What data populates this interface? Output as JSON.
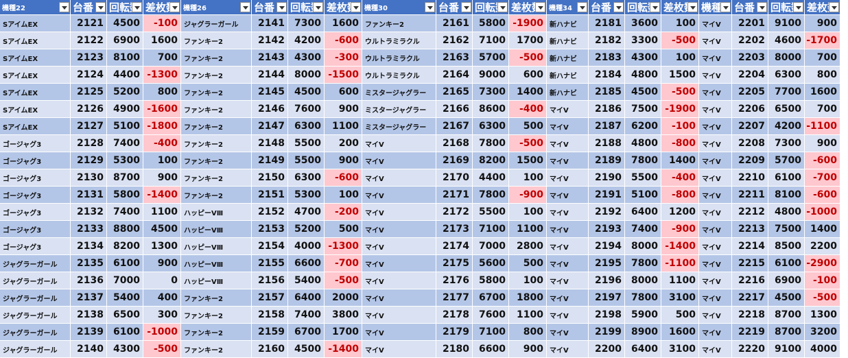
{
  "colors": {
    "header_bg": "#4472c4",
    "band_dark": "#b4c6e7",
    "band_light": "#d9e1f2",
    "negative_fill": "#ffc7ce",
    "negative_text": "#c00000"
  },
  "headers": [
    {
      "label": "機種22",
      "size": "small"
    },
    {
      "label": "台番",
      "size": "big"
    },
    {
      "label": "回転数",
      "size": "big"
    },
    {
      "label": "差枚数",
      "size": "big"
    },
    {
      "label": "機種26",
      "size": "small"
    },
    {
      "label": "台番",
      "size": "big"
    },
    {
      "label": "回転数",
      "size": "big"
    },
    {
      "label": "差枚数",
      "size": "big"
    },
    {
      "label": "機種30",
      "size": "small"
    },
    {
      "label": "台番",
      "size": "big"
    },
    {
      "label": "回転数",
      "size": "big"
    },
    {
      "label": "差枚数",
      "size": "big"
    },
    {
      "label": "機種34",
      "size": "small"
    },
    {
      "label": "台番",
      "size": "big"
    },
    {
      "label": "回転数",
      "size": "big"
    },
    {
      "label": "差枚数",
      "size": "big"
    },
    {
      "label": "機種",
      "size": "big"
    },
    {
      "label": "台番",
      "size": "big"
    },
    {
      "label": "回転数",
      "size": "big"
    },
    {
      "label": "差枚数",
      "size": "big"
    }
  ],
  "rows": [
    [
      "SアイムEX",
      "2121",
      "4500",
      "-100",
      "ジャグラーガール",
      "2141",
      "7300",
      "1600",
      "ファンキー2",
      "2161",
      "5800",
      "-1900",
      "新ハナビ",
      "2181",
      "3600",
      "100",
      "マイV",
      "2201",
      "9100",
      "900"
    ],
    [
      "SアイムEX",
      "2122",
      "6900",
      "1600",
      "ファンキー2",
      "2142",
      "4200",
      "-600",
      "ウルトラミラクル",
      "2162",
      "7100",
      "1700",
      "新ハナビ",
      "2182",
      "3300",
      "-500",
      "マイV",
      "2202",
      "4600",
      "-1700"
    ],
    [
      "SアイムEX",
      "2123",
      "8100",
      "700",
      "ファンキー2",
      "2143",
      "4300",
      "-300",
      "ウルトラミラクル",
      "2163",
      "5700",
      "-500",
      "新ハナビ",
      "2183",
      "4300",
      "100",
      "マイV",
      "2203",
      "8000",
      "700"
    ],
    [
      "SアイムEX",
      "2124",
      "4400",
      "-1300",
      "ファンキー2",
      "2144",
      "8000",
      "-1500",
      "ウルトラミラクル",
      "2164",
      "9000",
      "600",
      "新ハナビ",
      "2184",
      "4800",
      "1500",
      "マイV",
      "2204",
      "6300",
      "800"
    ],
    [
      "SアイムEX",
      "2125",
      "5200",
      "800",
      "ファンキー2",
      "2145",
      "4500",
      "600",
      "ミスタージャグラー",
      "2165",
      "7300",
      "1400",
      "新ハナビ",
      "2185",
      "4500",
      "-500",
      "マイV",
      "2205",
      "7700",
      "1600"
    ],
    [
      "SアイムEX",
      "2126",
      "4900",
      "-1600",
      "ファンキー2",
      "2146",
      "7600",
      "900",
      "ミスタージャグラー",
      "2166",
      "8600",
      "-400",
      "マイV",
      "2186",
      "7500",
      "-1900",
      "マイV",
      "2206",
      "6500",
      "700"
    ],
    [
      "SアイムEX",
      "2127",
      "5100",
      "-1800",
      "ファンキー2",
      "2147",
      "6300",
      "1100",
      "ミスタージャグラー",
      "2167",
      "6300",
      "500",
      "マイV",
      "2187",
      "6200",
      "-100",
      "マイV",
      "2207",
      "4200",
      "-1100"
    ],
    [
      "ゴージャグ3",
      "2128",
      "7400",
      "-400",
      "ファンキー2",
      "2148",
      "5500",
      "200",
      "マイV",
      "2168",
      "7800",
      "-500",
      "マイV",
      "2188",
      "4800",
      "-800",
      "マイV",
      "2208",
      "7300",
      "900"
    ],
    [
      "ゴージャグ3",
      "2129",
      "5300",
      "100",
      "ファンキー2",
      "2149",
      "5500",
      "900",
      "マイV",
      "2169",
      "8200",
      "1500",
      "マイV",
      "2189",
      "7800",
      "1400",
      "マイV",
      "2209",
      "5700",
      "-600"
    ],
    [
      "ゴージャグ3",
      "2130",
      "8700",
      "900",
      "ファンキー2",
      "2150",
      "6300",
      "-600",
      "マイV",
      "2170",
      "4400",
      "100",
      "マイV",
      "2190",
      "5500",
      "-400",
      "マイV",
      "2210",
      "6100",
      "-700"
    ],
    [
      "ゴージャグ3",
      "2131",
      "5800",
      "-1400",
      "ファンキー2",
      "2151",
      "5300",
      "100",
      "マイV",
      "2171",
      "7800",
      "-900",
      "マイV",
      "2191",
      "5100",
      "-800",
      "マイV",
      "2211",
      "8100",
      "-600"
    ],
    [
      "ゴージャグ3",
      "2132",
      "7400",
      "1100",
      "ハッピーVⅢ",
      "2152",
      "4700",
      "-200",
      "マイV",
      "2172",
      "5500",
      "100",
      "マイV",
      "2192",
      "6400",
      "1200",
      "マイV",
      "2212",
      "4800",
      "-1000"
    ],
    [
      "ゴージャグ3",
      "2133",
      "8800",
      "4500",
      "ハッピーVⅢ",
      "2153",
      "5200",
      "500",
      "マイV",
      "2173",
      "7100",
      "1100",
      "マイV",
      "2193",
      "7400",
      "-900",
      "マイV",
      "2213",
      "7500",
      "1400"
    ],
    [
      "ゴージャグ3",
      "2134",
      "8200",
      "1300",
      "ハッピーVⅢ",
      "2154",
      "4000",
      "-1300",
      "マイV",
      "2174",
      "7000",
      "2800",
      "マイV",
      "2194",
      "8000",
      "-1400",
      "マイV",
      "2214",
      "8500",
      "2200"
    ],
    [
      "ジャグラーガール",
      "2135",
      "6100",
      "900",
      "ハッピーVⅢ",
      "2155",
      "6600",
      "-700",
      "マイV",
      "2175",
      "5600",
      "500",
      "マイV",
      "2195",
      "7800",
      "-1100",
      "マイV",
      "2215",
      "6100",
      "-2900"
    ],
    [
      "ジャグラーガール",
      "2136",
      "7000",
      "0",
      "ハッピーVⅢ",
      "2156",
      "5400",
      "-500",
      "マイV",
      "2176",
      "5800",
      "100",
      "マイV",
      "2196",
      "8000",
      "1100",
      "マイV",
      "2216",
      "6900",
      "-100"
    ],
    [
      "ジャグラーガール",
      "2137",
      "5400",
      "400",
      "ファンキー2",
      "2157",
      "6400",
      "2000",
      "マイV",
      "2177",
      "6700",
      "1800",
      "マイV",
      "2197",
      "7800",
      "3100",
      "マイV",
      "2217",
      "4500",
      "-500"
    ],
    [
      "ジャグラーガール",
      "2138",
      "6500",
      "300",
      "ファンキー2",
      "2158",
      "7400",
      "3800",
      "マイV",
      "2178",
      "7600",
      "1100",
      "マイV",
      "2198",
      "5900",
      "500",
      "マイV",
      "2218",
      "8700",
      "1300"
    ],
    [
      "ジャグラーガール",
      "2139",
      "6100",
      "-1000",
      "ファンキー2",
      "2159",
      "6700",
      "1700",
      "マイV",
      "2179",
      "7100",
      "800",
      "マイV",
      "2199",
      "8900",
      "1600",
      "マイV",
      "2219",
      "8700",
      "3200"
    ],
    [
      "ジャグラーガール",
      "2140",
      "4300",
      "-500",
      "ファンキー2",
      "2160",
      "4500",
      "-1400",
      "マイV",
      "2180",
      "6600",
      "900",
      "マイV",
      "2200",
      "6400",
      "3100",
      "マイV",
      "2220",
      "9100",
      "4000"
    ]
  ]
}
